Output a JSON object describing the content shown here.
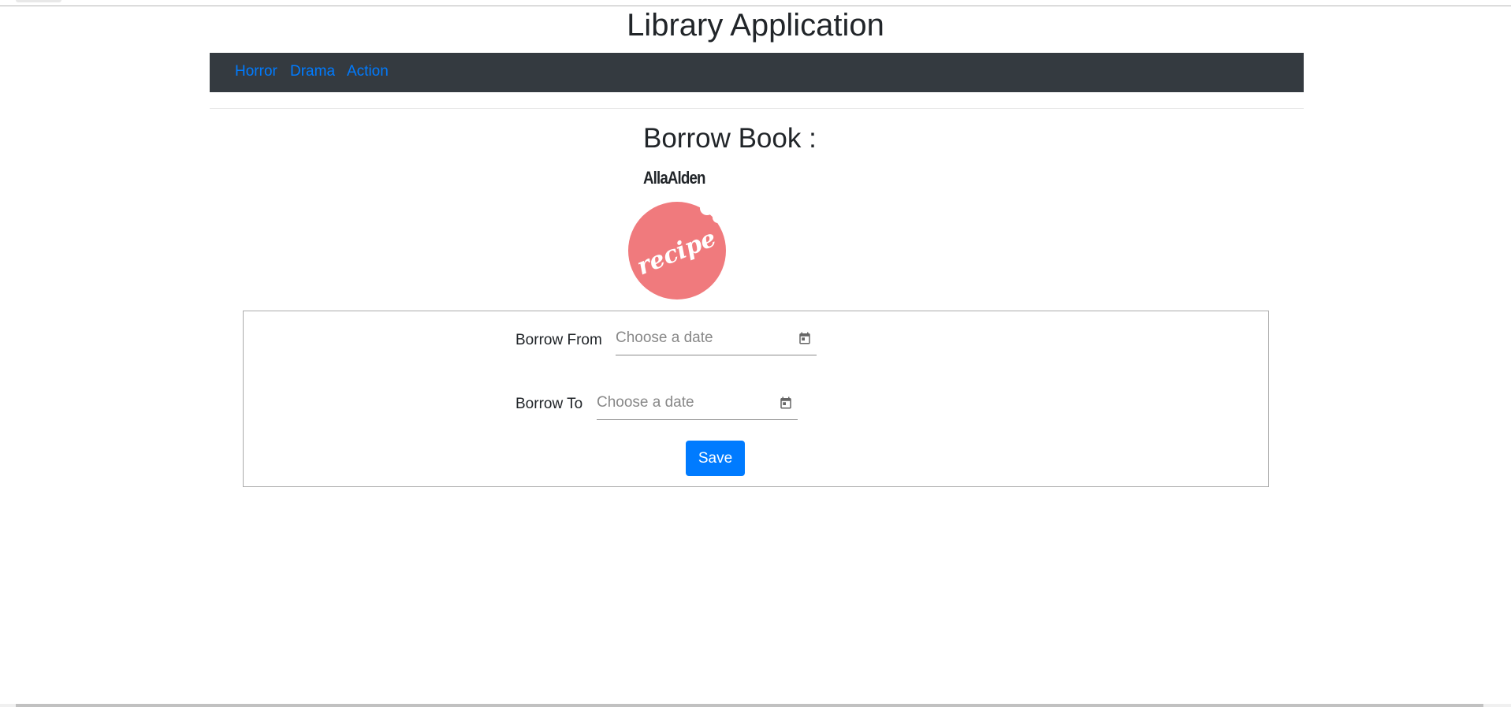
{
  "header": {
    "title": "Library Application"
  },
  "nav": {
    "items": [
      {
        "label": "Horror"
      },
      {
        "label": "Drama"
      },
      {
        "label": "Action"
      }
    ],
    "link_color": "#007bff",
    "bg": "#343a40"
  },
  "main": {
    "heading": "Borrow Book :",
    "author": "AllaAlden",
    "cover": {
      "logo_text": "recipe",
      "color": "#f07a7d"
    },
    "form": {
      "borrow_from": {
        "label": "Borrow From",
        "placeholder": "Choose a date",
        "value": ""
      },
      "borrow_to": {
        "label": "Borrow To",
        "placeholder": "Choose a date",
        "value": ""
      },
      "save_label": "Save"
    }
  }
}
